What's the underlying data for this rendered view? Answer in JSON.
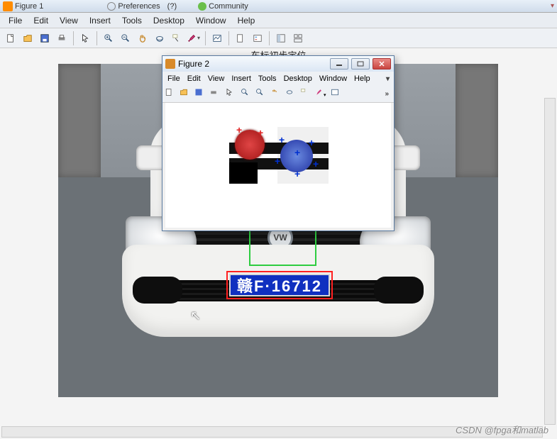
{
  "titlebar": {
    "window_title": "Figure 1",
    "pref_label": "Preferences",
    "community_label": "Community"
  },
  "menubar": {
    "items": [
      "File",
      "Edit",
      "View",
      "Insert",
      "Tools",
      "Desktop",
      "Window",
      "Help"
    ]
  },
  "toolbar_icons": {
    "new": "new-file-icon",
    "open": "open-folder-icon",
    "save": "save-icon",
    "print": "print-icon",
    "pointer": "pointer-icon",
    "zoomin": "zoom-in-icon",
    "zoomout": "zoom-out-icon",
    "pan": "pan-hand-icon",
    "rotate": "rotate-3d-icon",
    "datacursor": "data-cursor-icon",
    "brush": "brush-icon",
    "link": "link-plot-icon",
    "colorbar": "colorbar-icon",
    "legend": "legend-icon",
    "dock": "dock-icon",
    "layout": "layout-icon"
  },
  "figure": {
    "title_text": "车标初步定位",
    "plate_text": "赣F·16712"
  },
  "subwindow": {
    "title": "Figure 2",
    "menu_items": [
      "File",
      "Edit",
      "View",
      "Insert",
      "Tools",
      "Desktop",
      "Window",
      "Help"
    ]
  },
  "watermark": "CSDN @fpga和matlab"
}
